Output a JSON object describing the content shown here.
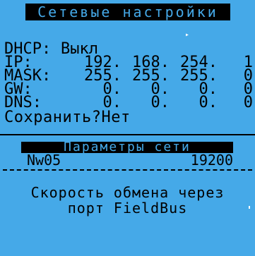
{
  "header": {
    "title": "Сетевые настройки"
  },
  "settings": {
    "dhcp": {
      "label": "DHCP:",
      "value": "Выкл"
    },
    "ip": {
      "label": "IP:",
      "o1": "192.",
      "o2": "168.",
      "o3": "254.",
      "o4": "1"
    },
    "mask": {
      "label": "MASK:",
      "o1": "255.",
      "o2": "255.",
      "o3": "255.",
      "o4": "0"
    },
    "gw": {
      "label": "GW:",
      "o1": "0.",
      "o2": "0.",
      "o3": "0.",
      "o4": "0"
    },
    "dns": {
      "label": "DNS:",
      "o1": "0.",
      "o2": "0.",
      "o3": "0.",
      "o4": "0"
    },
    "save": "Сохранить?Нет"
  },
  "params": {
    "title": "Параметры сети",
    "name": "Nw05",
    "value": "19200"
  },
  "description": {
    "line1": "Скорость обмена через",
    "line2": "порт FieldBus"
  }
}
